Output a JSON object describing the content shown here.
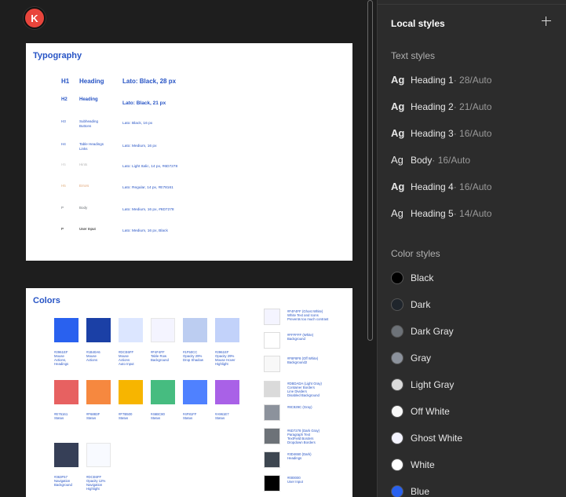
{
  "user": {
    "initial": "K",
    "color": "#e8453c"
  },
  "typography": {
    "title": "Typography",
    "rows": [
      {
        "tag": "H1",
        "name": "Heading",
        "spec": "Lato: Black, 28 px"
      },
      {
        "tag": "H2",
        "name": "Heading",
        "spec": "Lato: Black, 21 px"
      },
      {
        "tag": "H3",
        "name": "Subheading\nButtons",
        "spec": "Lato: Black, 16 px"
      },
      {
        "tag": "H4",
        "name": "Table Headings\nLinks",
        "spec": "Lato: Medium, 16 px"
      },
      {
        "tag": "H5",
        "name": "Hints",
        "spec": "Lato: Light Italic, 14 px, #6D7278"
      },
      {
        "tag": "H5",
        "name": "Errors",
        "spec": "Lato: Regular, 14 px, #E78161"
      },
      {
        "tag": "P",
        "name": "Body",
        "spec": "Lato: Medium, 16 px, #6D7278"
      },
      {
        "tag": "P",
        "name": "User Input",
        "spec": "Lato: Medium, 16 px, Black"
      }
    ]
  },
  "colors_frame": {
    "title": "Colors",
    "swatches": [
      {
        "color": "#2961EF",
        "label": "#2961EF\nMouse\nActions,\nHeadings"
      },
      {
        "color": "#1B40A6",
        "label": "#1B40A6\nMouse\nActions"
      },
      {
        "color": "#DCE6FF",
        "label": "#DCE6FF\nMouse\nActions\nAuto Input"
      },
      {
        "color": "#F4F4FF",
        "label": "#F4F4FF\nTable Row\nBackground"
      },
      {
        "color": "#BCCDF1",
        "label": "#1F50CC\nOpacity 29%\nDrop Shadow"
      },
      {
        "color": "#C2D2FA",
        "label": "#2961EF\nOpacity 29%\nMouse Hover\nHighlight"
      },
      {
        "color": "#E76161",
        "label": "#E76161\nStatus"
      },
      {
        "color": "#F6883F",
        "label": "#F6883F\nStatus"
      },
      {
        "color": "#F7B500",
        "label": "#F7B500\nStatus"
      },
      {
        "color": "#46BC80",
        "label": "#46BC80\nStatus"
      },
      {
        "color": "#4F81FF",
        "label": "#4F81FF\nStatus"
      },
      {
        "color": "#A961E7",
        "label": "#A961E7\nStatus"
      },
      {
        "color": "#363F57",
        "label": "#363F57\nNavigation\nBackground"
      },
      {
        "color": "#F8FAFF",
        "label": "#DCE6FF\nOpacity 12%\nNavigation\nHighlight"
      }
    ],
    "neutrals": [
      {
        "color": "#F4F4FF",
        "label": "#F4F4FF (Ghost White)\nWhite Text and Icons\nPrevents too much contrast"
      },
      {
        "color": "#FFFFFF",
        "label": "#FFFFFF (White)\nBackground"
      },
      {
        "color": "#F8F8F8",
        "label": "#F8F8F8 (Off White)\nBackground2"
      },
      {
        "color": "#DADADA",
        "label": "#DBDADA (Light Gray)\nContainer Borders\nLine Dividers\nDisabled Background"
      },
      {
        "color": "#8C929C",
        "label": "#8C929C (Gray)"
      },
      {
        "color": "#6D7278",
        "label": "#6D7278 (Dark Gray)\nParagraph Text\nTextField Borders\nDropdown Borders"
      },
      {
        "color": "#3D4650",
        "label": "#3D4650 (Dark)\nHeadings"
      },
      {
        "color": "#000000",
        "label": "#000000\nUser Input"
      }
    ]
  },
  "panel": {
    "title": "Local styles",
    "text_section": "Text styles",
    "text_styles": [
      {
        "ag": "Ag",
        "name": "Heading 1",
        "meta": " · 28/Auto"
      },
      {
        "ag": "Ag",
        "name": "Heading 2",
        "meta": " · 21/Auto"
      },
      {
        "ag": "Ag",
        "name": "Heading 3",
        "meta": " · 16/Auto"
      },
      {
        "ag": "Ag",
        "name": "Body",
        "meta": " · 16/Auto"
      },
      {
        "ag": "Ag",
        "name": "Heading 4",
        "meta": " · 16/Auto"
      },
      {
        "ag": "Ag",
        "name": "Heading 5",
        "meta": " · 14/Auto"
      }
    ],
    "color_section": "Color styles",
    "color_styles": [
      {
        "name": "Black",
        "color": "#000000"
      },
      {
        "name": "Dark",
        "color": "#1f252c"
      },
      {
        "name": "Dark Gray",
        "color": "#6D7278"
      },
      {
        "name": "Gray",
        "color": "#8C929C"
      },
      {
        "name": "Light Gray",
        "color": "#DADADA"
      },
      {
        "name": "Off White",
        "color": "#F8F8F8"
      },
      {
        "name": "Ghost White",
        "color": "#F4F4FF"
      },
      {
        "name": "White",
        "color": "#FFFFFF"
      },
      {
        "name": "Blue",
        "color": "#2961EF"
      }
    ]
  }
}
